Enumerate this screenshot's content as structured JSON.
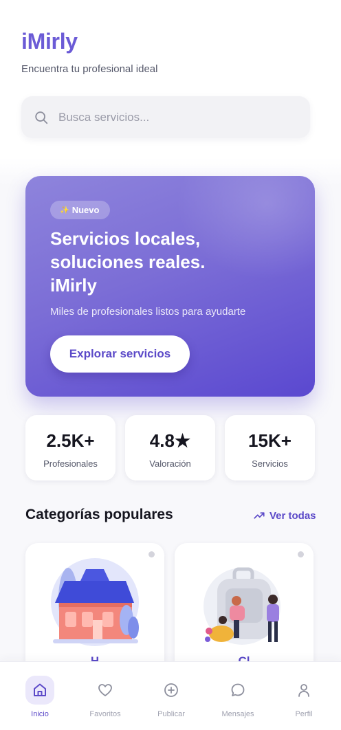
{
  "app": {
    "title": "iMirly",
    "tagline": "Encuentra tu profesional ideal"
  },
  "search": {
    "placeholder": "Busca servicios...",
    "icon": "search-icon"
  },
  "hero": {
    "badge": "Nuevo",
    "badge_icon": "✨",
    "title_lines": [
      "Servicios locales,",
      "soluciones reales.",
      "iMirly"
    ],
    "subtitle": "Miles de profesionales listos para ayudarte",
    "button": "Explorar servicios"
  },
  "stats": [
    {
      "value": "2.5K+",
      "label": "Profesionales"
    },
    {
      "value": "4.8★",
      "label": "Valoración"
    },
    {
      "value": "15K+",
      "label": "Servicios"
    }
  ],
  "categories": {
    "title": "Categorías populares",
    "see_all": "Ver todas",
    "items": [
      {
        "label": "H"
      },
      {
        "label": "Cl"
      }
    ]
  },
  "tabs": [
    {
      "label": "Inicio",
      "icon": "home-icon",
      "active": true
    },
    {
      "label": "Favoritos",
      "icon": "heart-icon",
      "active": false
    },
    {
      "label": "Publicar",
      "icon": "plus-circle-icon",
      "active": false
    },
    {
      "label": "Mensajes",
      "icon": "chat-icon",
      "active": false
    },
    {
      "label": "Perfil",
      "icon": "user-icon",
      "active": false
    }
  ],
  "colors": {
    "brand": "#6b5bd6",
    "accent": "#5b49c8",
    "hero_gradient_start": "#8e84dc",
    "hero_gradient_end": "#5a48d0"
  }
}
